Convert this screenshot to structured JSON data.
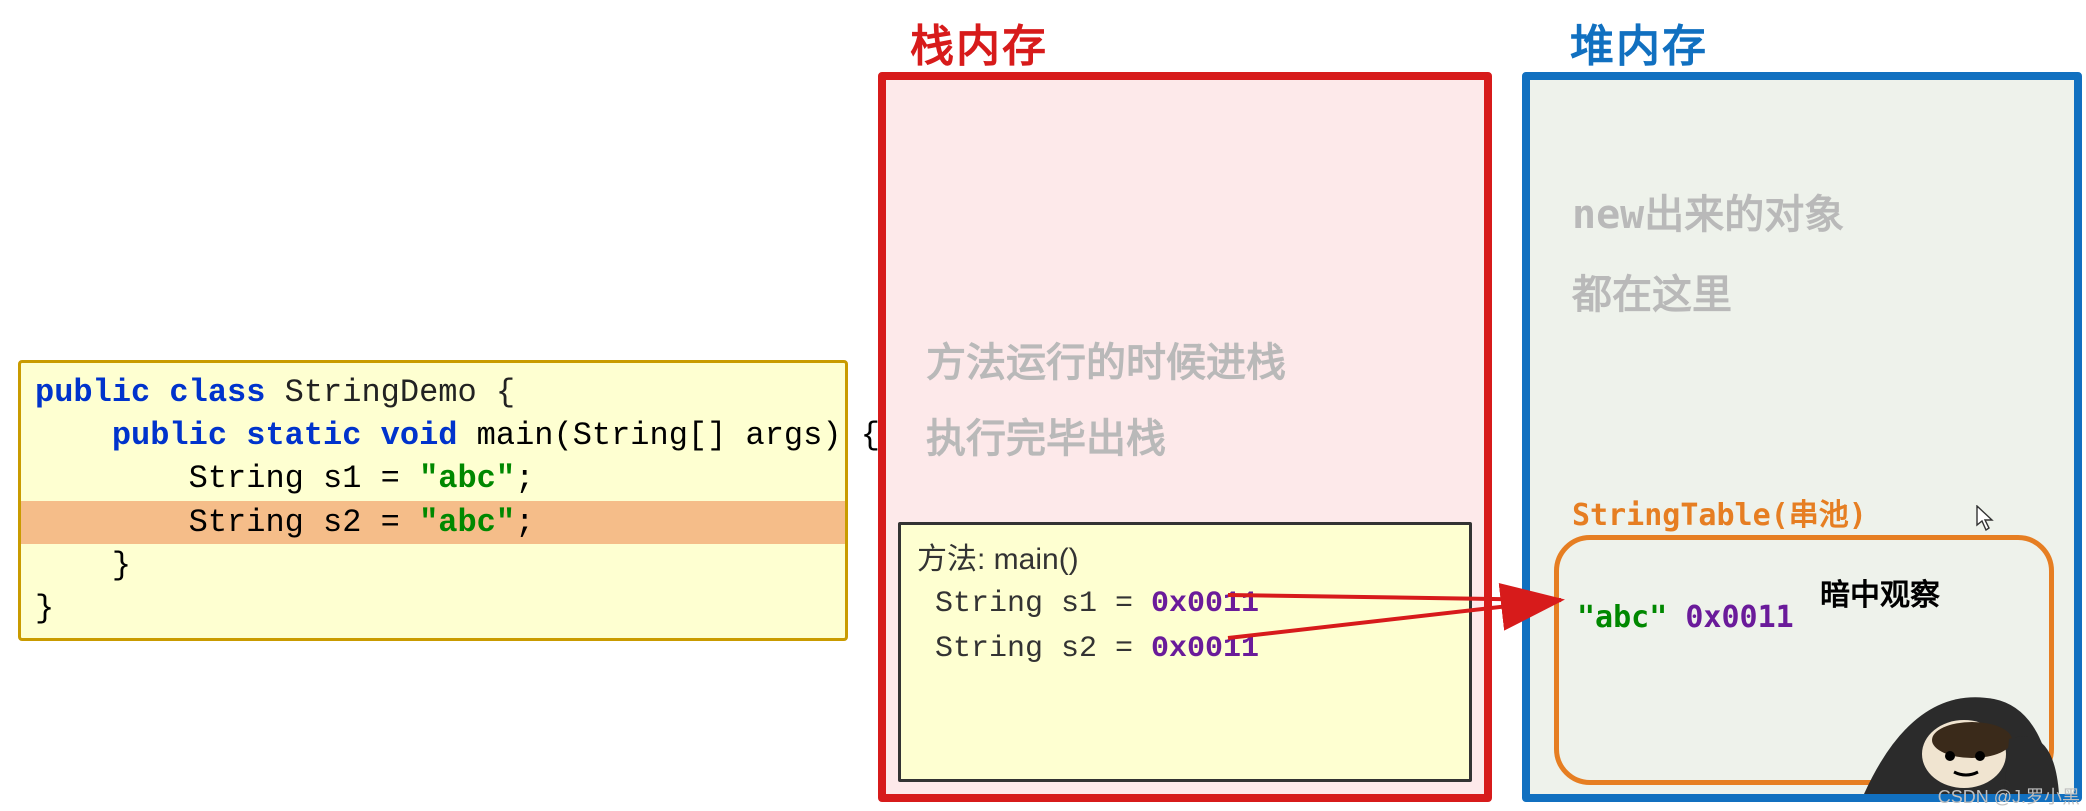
{
  "headings": {
    "stack": "栈内存",
    "heap": "堆内存"
  },
  "code": {
    "line1_kw1": "public",
    "line1_kw2": "class",
    "line1_rest": " StringDemo {",
    "line2_kw1": "public",
    "line2_kw2": "static",
    "line2_kw3": "void",
    "line2_rest": " main(String[] args) {",
    "line3_lhs": "        String s1 = ",
    "line3_str": "\"abc\"",
    "line3_semi": ";",
    "line4_lhs": "        String s2 = ",
    "line4_str": "\"abc\"",
    "line4_semi": ";",
    "line5": "    }",
    "line6": "}"
  },
  "stack": {
    "watermark_l1": "方法运行的时候进栈",
    "watermark_l2": "执行完毕出栈",
    "method_title": "方法: main()",
    "s1_lhs": " String s1 = ",
    "s1_addr": "0x0011",
    "s2_lhs": " String s2 = ",
    "s2_addr": "0x0011"
  },
  "heap": {
    "watermark_l1": "new出来的对象",
    "watermark_l2": "都在这里",
    "string_table_label": "StringTable(串池)",
    "entry_str": "\"abc\"",
    "entry_addr": "0x0011",
    "watch_text": "暗中观察"
  },
  "corner_watermark": "CSDN @J.罗小黑",
  "colors": {
    "stack_border": "#d71b1b",
    "heap_border": "#1170c0",
    "string_table_border": "#e67e22",
    "code_bg": "#feffd1",
    "keyword": "#0033cc",
    "string_literal": "#008800",
    "address": "#6a1b9a"
  }
}
